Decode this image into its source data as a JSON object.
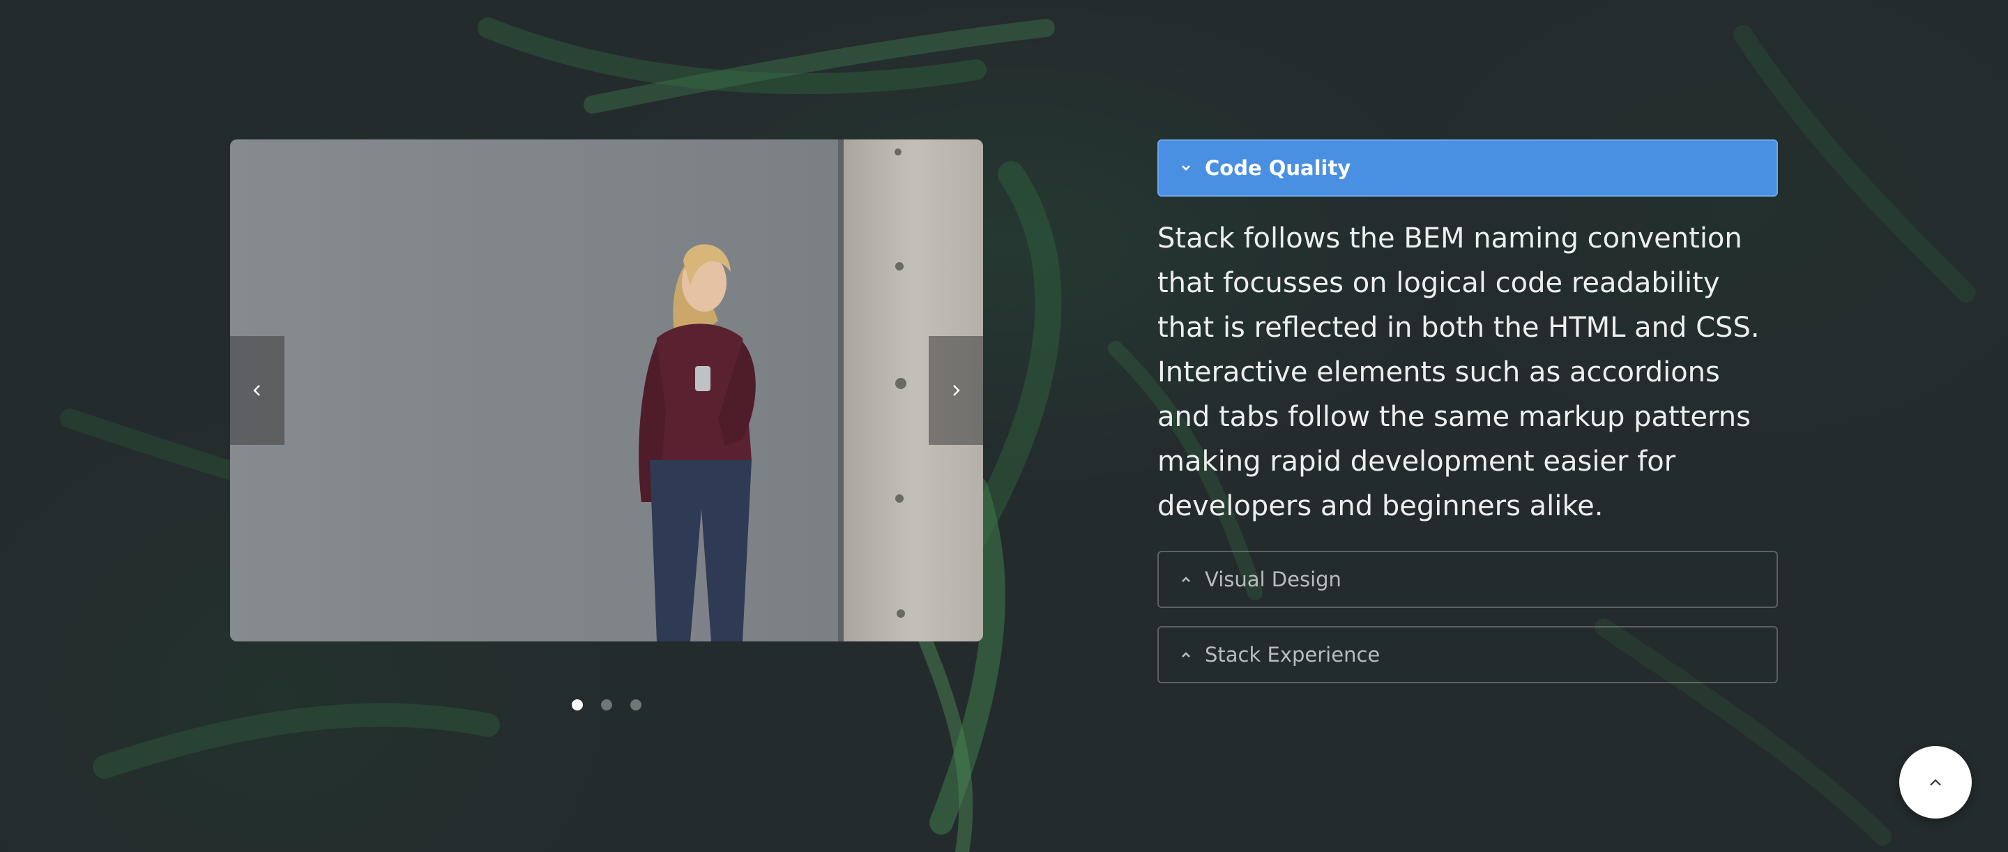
{
  "slider": {
    "prev_icon": "chevron-left-icon",
    "next_icon": "chevron-right-icon",
    "slide_count": 3,
    "active_slide": 1
  },
  "accordion": {
    "items": [
      {
        "title": "Code Quality",
        "expanded": true,
        "content": "Stack follows the BEM naming convention that focusses on logical code readability that is reflected in both the HTML and CSS. Interactive elements such as accordions and tabs follow the same markup patterns making rapid development easier for developers and beginners alike."
      },
      {
        "title": "Visual Design",
        "expanded": false
      },
      {
        "title": "Stack Experience",
        "expanded": false
      }
    ]
  },
  "colors": {
    "accent": "#4a90e2",
    "background": "#242b2d"
  },
  "back_to_top_icon": "chevron-up-icon"
}
